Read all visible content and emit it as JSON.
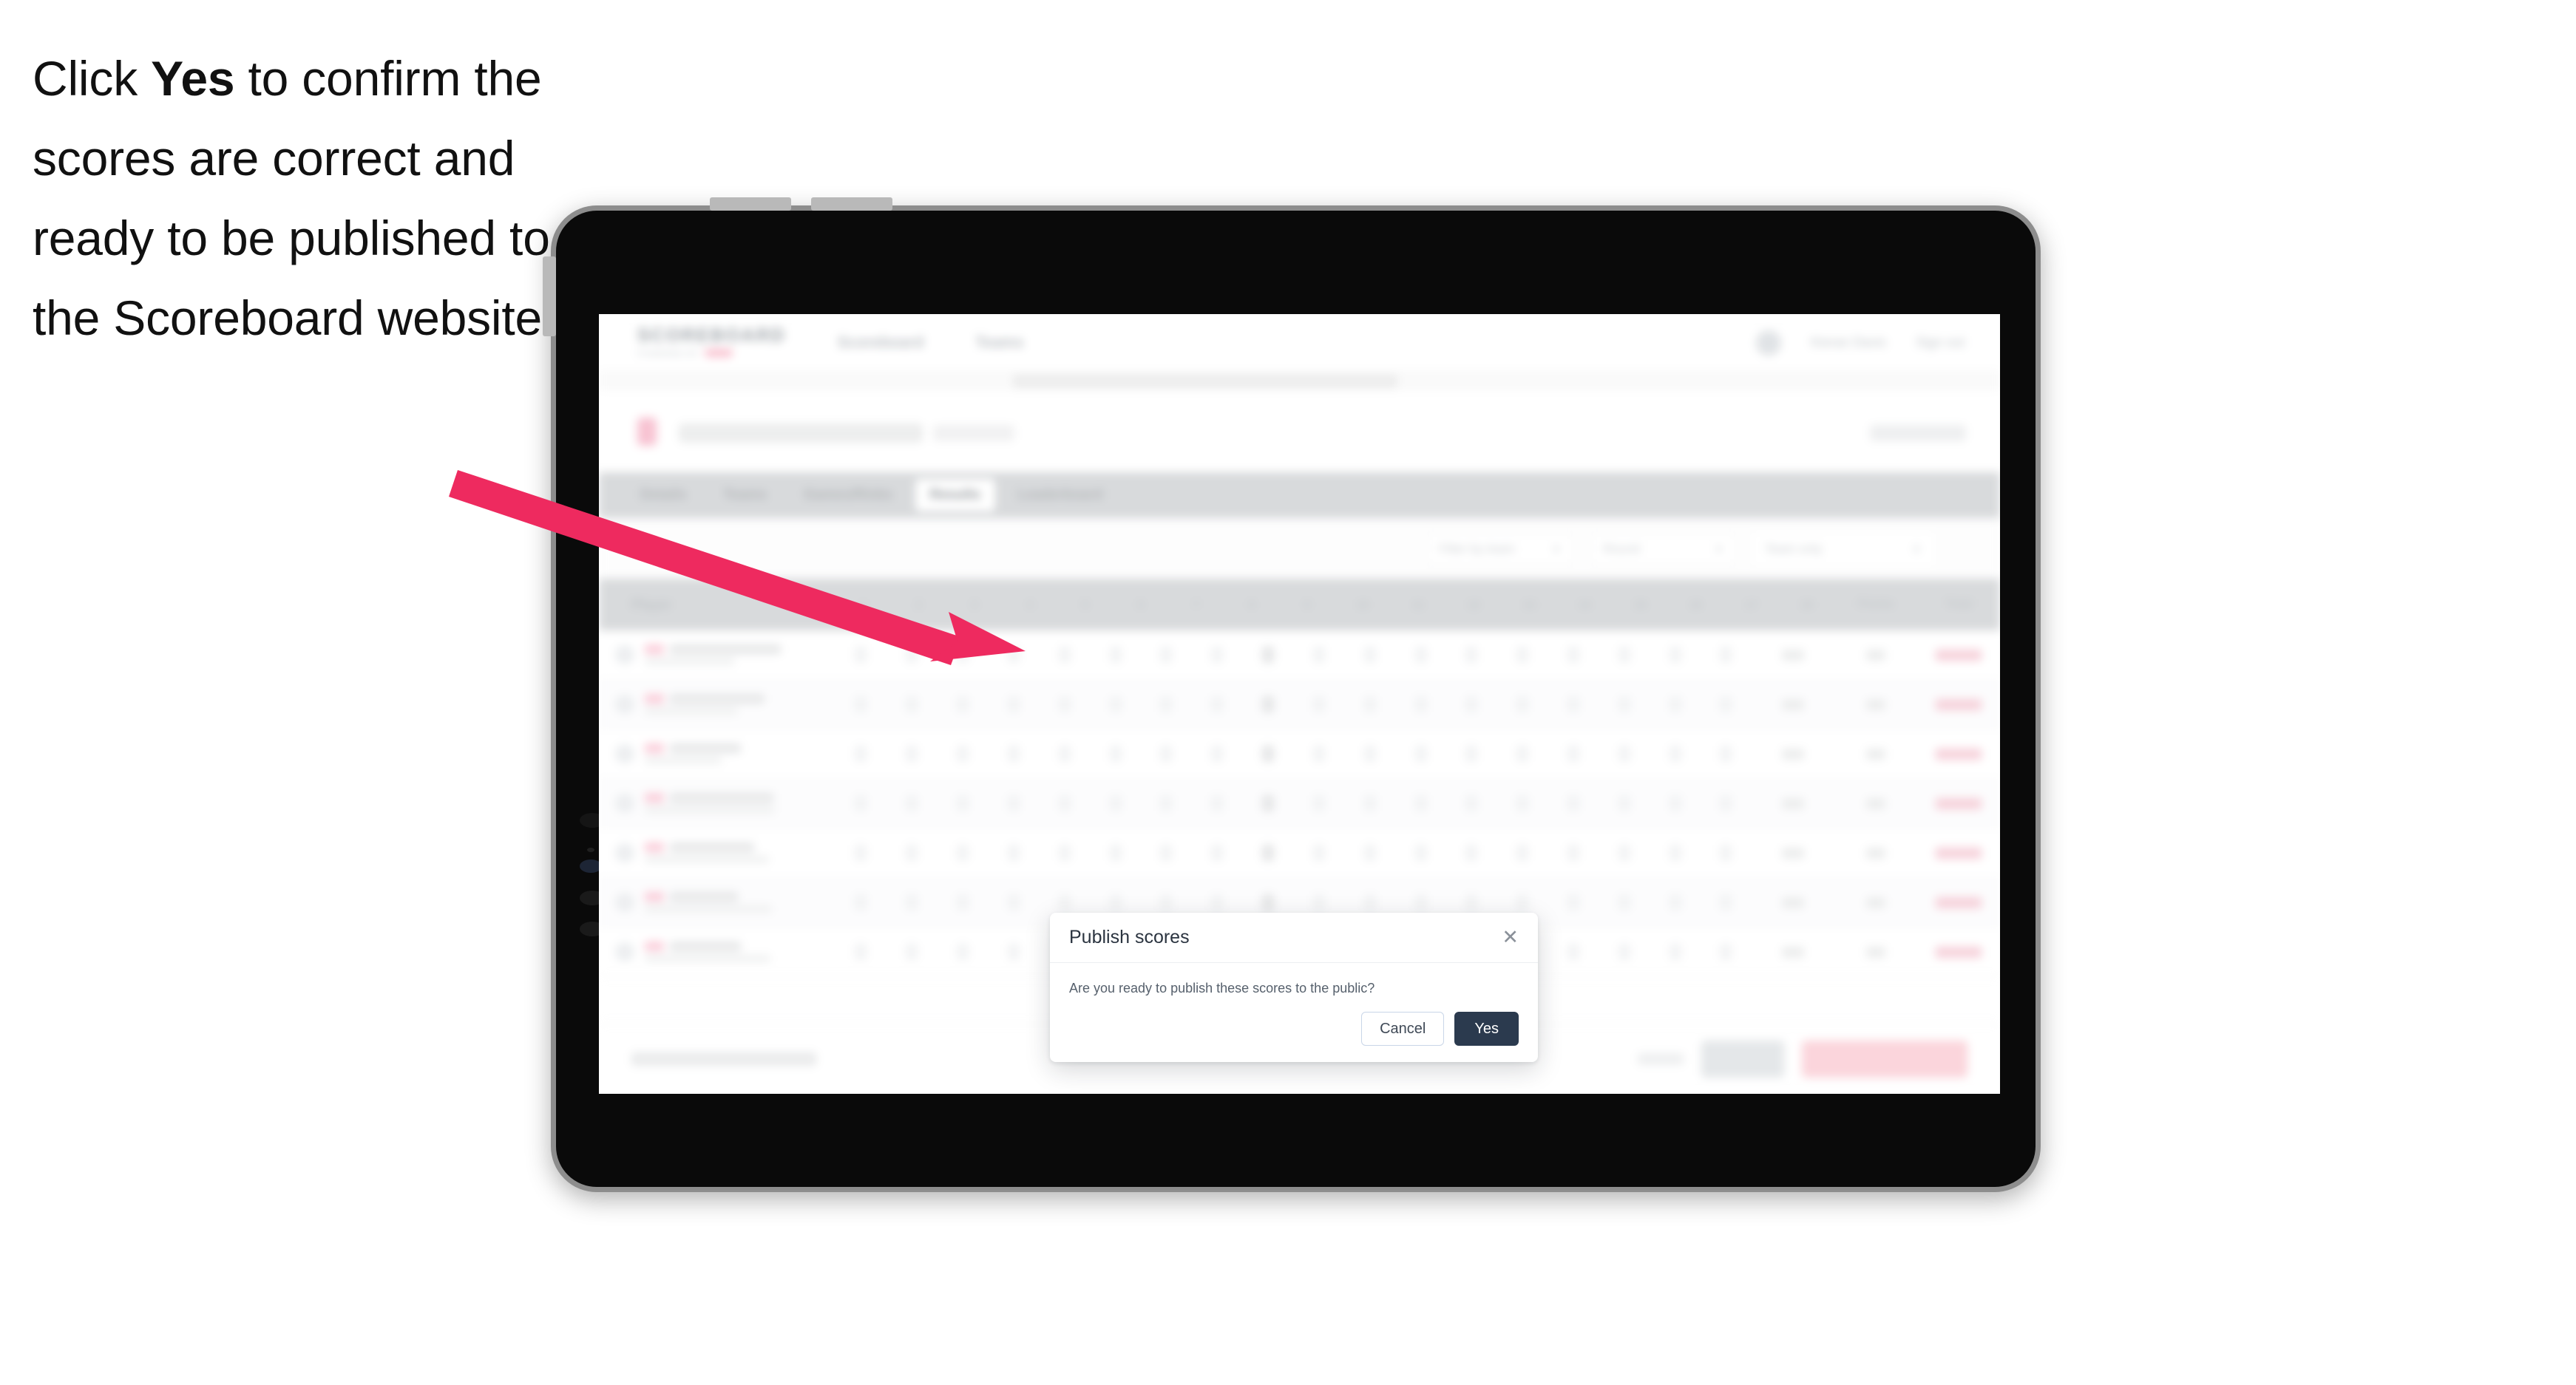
{
  "caption": {
    "prefix": "Click ",
    "bold": "Yes",
    "suffix": " to confirm the scores are correct and ready to be published to the Scoreboard website."
  },
  "colors": {
    "arrow": "#ee2a5f",
    "primary_button": "#2b3a4e",
    "accent_pink": "#f6cfd9",
    "tablet_body": "#0a0a0a",
    "tablet_edge": "#8d8d8d",
    "tab_bar": "#d6d8da"
  },
  "modal": {
    "title": "Publish scores",
    "message": "Are you ready to publish these scores to the public?",
    "close_icon": "close-icon",
    "buttons": {
      "cancel": "Cancel",
      "confirm": "Yes"
    }
  },
  "app": {
    "brand": {
      "name": "SCOREBOARD",
      "sub": "POWERED BY"
    },
    "topnav": [
      {
        "label": "Scoreboard"
      },
      {
        "label": "Teams"
      }
    ],
    "topbar_right": [
      {
        "label": "avatar",
        "icon": "avatar"
      },
      {
        "label": "Kieran Davis"
      },
      {
        "label": "Sign out"
      }
    ],
    "tabs": [
      {
        "label": "Details",
        "active": false
      },
      {
        "label": "Teams",
        "active": false
      },
      {
        "label": "Games/Rinks",
        "active": false
      },
      {
        "label": "Results",
        "active": true
      },
      {
        "label": "Leaderboard",
        "active": false
      }
    ],
    "filters": [
      {
        "label": "Filter by team",
        "icon": "chevron-down-icon"
      },
      {
        "label": "Round",
        "icon": "chevron-down-icon"
      },
      {
        "label": "Team only",
        "icon": "chevron-down-icon"
      }
    ],
    "table": {
      "header": {
        "player": "Player",
        "ends": [
          "1",
          "2",
          "3",
          "4",
          "5",
          "6",
          "7",
          "8",
          "9",
          "10",
          "11",
          "12",
          "13",
          "14",
          "15",
          "16",
          "17",
          "18"
        ],
        "points": "Points",
        "total": "Total",
        "shots": "Shots"
      },
      "rows": [
        {
          "name": "Marcus Tennant",
          "team": "Team Alpha"
        },
        {
          "name": "Rhys Parnell",
          "team": "Team College"
        },
        {
          "name": "Cameron Robertson",
          "team": "Team Two"
        },
        {
          "name": "Chris Fitzgerald",
          "team": "Greensborough Bowling Club"
        },
        {
          "name": "Robbie Stuart",
          "team": "Sunbeam Bowling Club"
        },
        {
          "name": "Hayes Webb",
          "team": "Greensborough Bowling Club"
        },
        {
          "name": "Beth Baker",
          "team": "Sunbeam Bowling Club"
        }
      ]
    },
    "footer": {
      "note": "Not all scores are complete",
      "link": "Cancel",
      "secondary_button": "Save",
      "primary_button": "Publish scores to public"
    }
  }
}
